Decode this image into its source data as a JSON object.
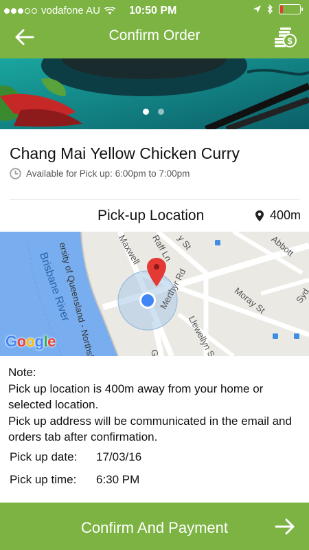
{
  "status_bar": {
    "carrier": "vodafone AU",
    "time": "10:50 PM",
    "battery_percent": 15,
    "signal_bars_filled": 3,
    "signal_bars_total": 5
  },
  "nav": {
    "title": "Confirm Order",
    "back_icon": "arrow-left-icon",
    "right_icon": "coins-payment-icon"
  },
  "hero": {
    "pages_total": 2,
    "active_page": 1
  },
  "item": {
    "title": "Chang Mai Yellow Chicken Curry",
    "availability": "Available for Pick up: 6:00pm to 7:00pm"
  },
  "location": {
    "heading": "Pick-up Location",
    "distance": "400m"
  },
  "map": {
    "streets": [
      "Maxwell",
      "Raff Ln",
      "y St",
      "Abbott",
      "Merthyr Rd",
      "Moray St",
      "Llewellyn St",
      "Syd",
      "ersity of Queensland - Northsh",
      "G"
    ],
    "river": "Brisbane River",
    "attribution": "Google"
  },
  "note": {
    "heading": "Note:",
    "line1": "Pick up location is 400m away from your home or selected location.",
    "line2": "Pick up address will be communicated in the email and orders tab after confirmation."
  },
  "pickup": {
    "date_label": "Pick up date:",
    "date_value": "17/03/16",
    "time_label": "Pick up time:",
    "time_value": "6:30 PM"
  },
  "confirm": {
    "label": "Confirm And Payment",
    "icon": "arrow-right-icon"
  },
  "colors": {
    "accent": "#7cb342",
    "map_water": "#78aef0",
    "pin": "#e53935",
    "location_dot": "#4285f4"
  }
}
